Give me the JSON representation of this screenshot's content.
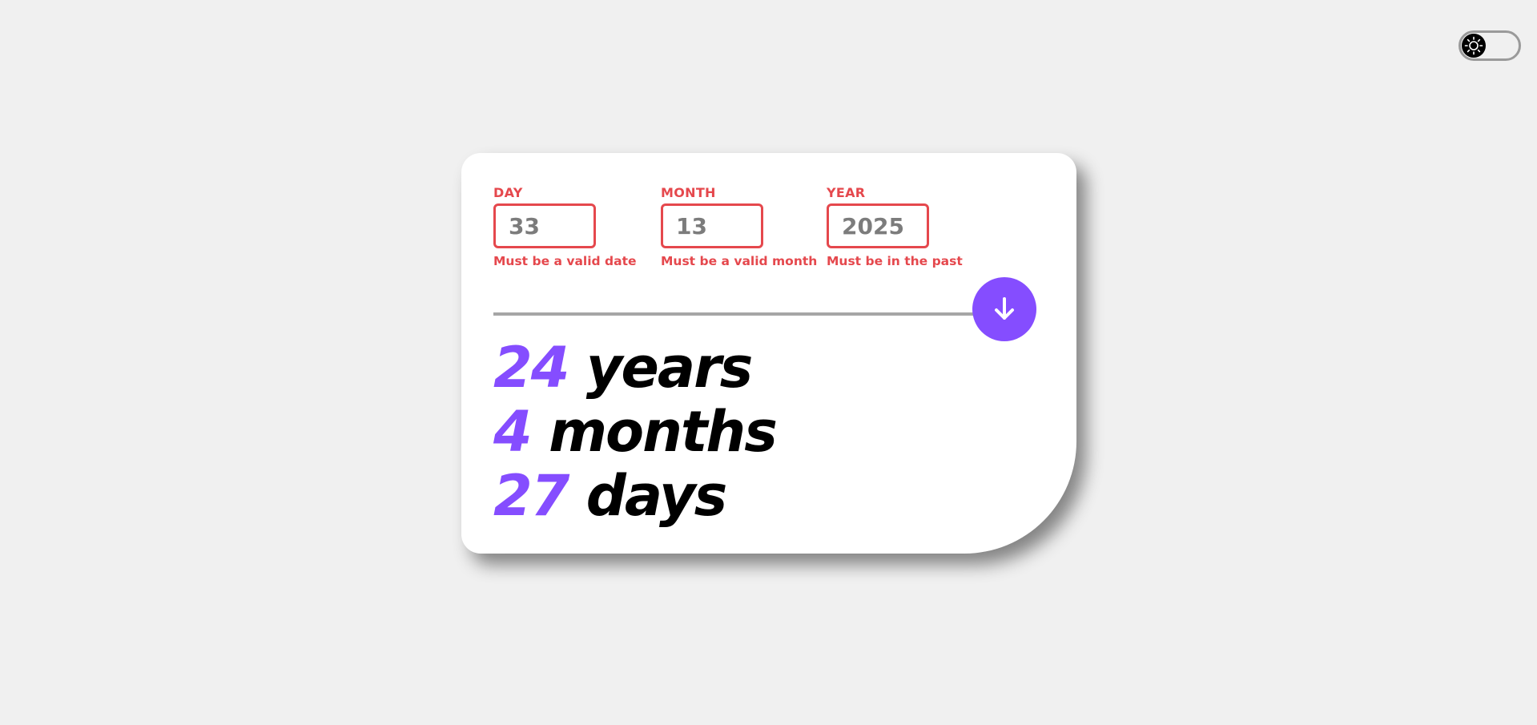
{
  "theme_toggle": {
    "icon": "sun-icon",
    "mode": "light"
  },
  "form": {
    "day": {
      "label": "DAY",
      "value": "33",
      "error": "Must be a valid date"
    },
    "month": {
      "label": "MONTH",
      "value": "13",
      "error": "Must be a valid month"
    },
    "year": {
      "label": "YEAR",
      "value": "2025",
      "error": "Must be in the past"
    }
  },
  "submit": {
    "icon": "arrow-down-icon"
  },
  "results": {
    "years": {
      "value": "24",
      "unit": "years"
    },
    "months": {
      "value": "4",
      "unit": "months"
    },
    "days": {
      "value": "27",
      "unit": "days"
    }
  },
  "colors": {
    "accent": "#854dff",
    "error": "#e5484d",
    "background": "#f0f0f0",
    "card": "#ffffff"
  }
}
